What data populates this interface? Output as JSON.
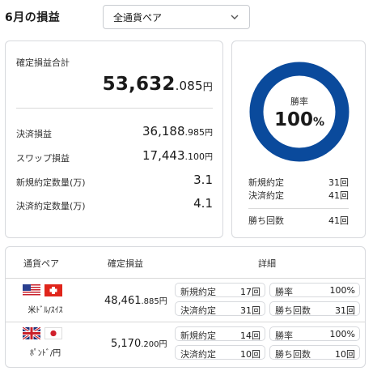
{
  "header": {
    "title": "6月の損益"
  },
  "pair_select": {
    "selected": "全通貨ペア"
  },
  "summary": {
    "total_label": "確定損益合計",
    "total_int": "53,632",
    "total_dec": ".085",
    "yen": "円",
    "rows": [
      {
        "label": "決済損益",
        "int": "36,188",
        "dec": ".985",
        "yen": "円"
      },
      {
        "label": "スワップ損益",
        "int": "17,443",
        "dec": ".100",
        "yen": "円"
      },
      {
        "label": "新規約定数量(万)",
        "int": "3.1",
        "dec": "",
        "yen": ""
      },
      {
        "label": "決済約定数量(万)",
        "int": "4.1",
        "dec": "",
        "yen": ""
      }
    ]
  },
  "win": {
    "label": "勝率",
    "value": "100",
    "pct": "%",
    "rate": 1.0,
    "ring_color": "#0a4a9c",
    "rows": [
      {
        "label": "新規約定",
        "value": "31回"
      },
      {
        "label": "決済約定",
        "value": "41回"
      },
      {
        "label": "勝ち回数",
        "value": "41回"
      }
    ]
  },
  "table": {
    "headers": {
      "pair": "通貨ペア",
      "pnl": "確定損益",
      "detail": "詳細"
    },
    "rows": [
      {
        "pair": "米ﾄﾞﾙ/ｽｲｽ",
        "pnl_int": "48,461",
        "pnl_dec": ".885",
        "yen": "円",
        "chips": [
          {
            "label": "新規約定",
            "value": "17回"
          },
          {
            "label": "勝率",
            "value": "100%"
          },
          {
            "label": "決済約定",
            "value": "31回"
          },
          {
            "label": "勝ち回数",
            "value": "31回"
          }
        ]
      },
      {
        "pair": "ﾎﾟﾝﾄﾞ/円",
        "pnl_int": "5,170",
        "pnl_dec": ".200",
        "yen": "円",
        "chips": [
          {
            "label": "新規約定",
            "value": "14回"
          },
          {
            "label": "勝率",
            "value": "100%"
          },
          {
            "label": "決済約定",
            "value": "10回"
          },
          {
            "label": "勝ち回数",
            "value": "10回"
          }
        ]
      }
    ]
  }
}
